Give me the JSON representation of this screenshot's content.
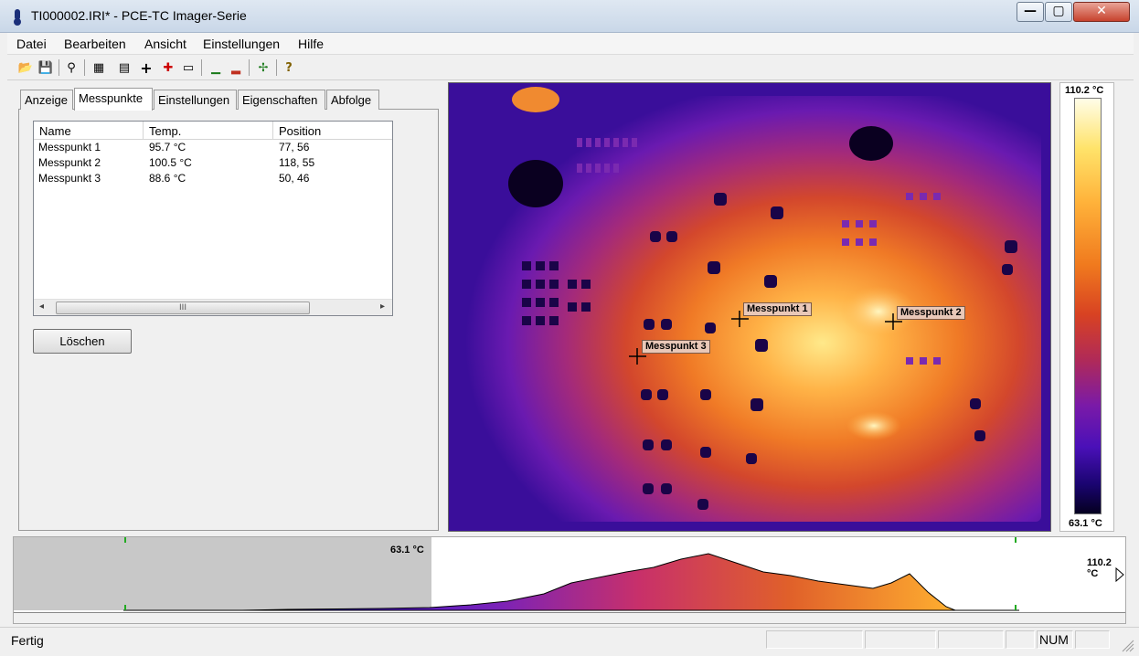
{
  "window": {
    "title": "TI000002.IRI* - PCE-TC Imager-Serie",
    "min_glyph": "—",
    "max_glyph": "▢",
    "close_glyph": "✕"
  },
  "menu": [
    "Datei",
    "Bearbeiten",
    "Ansicht",
    "Einstellungen",
    "Hilfe"
  ],
  "toolbar": {
    "icons": [
      "open-folder-icon",
      "save-icon",
      "binoculars-icon",
      "properties-icon",
      "report-icon",
      "crosshair-icon",
      "add-point-icon",
      "rectangle-icon",
      "histogram-icon",
      "bar-chart-icon",
      "line-profile-icon",
      "help-icon"
    ],
    "glyphs": [
      "📂",
      "💾",
      "⚲",
      "▦",
      "▤",
      "+",
      "✚",
      "▭",
      "▁",
      "▂",
      "✢",
      "?"
    ]
  },
  "tabs": [
    "Anzeige",
    "Messpunkte",
    "Einstellungen",
    "Eigenschaften",
    "Abfolge"
  ],
  "active_tab": "Messpunkte",
  "points_table": {
    "headers": [
      "Name",
      "Temp.",
      "Position"
    ],
    "rows": [
      [
        "Messpunkt 1",
        "95.7 °C",
        "77, 56"
      ],
      [
        "Messpunkt 2",
        "100.5 °C",
        "118, 55"
      ],
      [
        "Messpunkt 3",
        "88.6 °C",
        "50, 46"
      ]
    ],
    "scroll_left": "◂",
    "scroll_right": "▸",
    "scroll_thumb": "III"
  },
  "delete_button": "Löschen",
  "thermal_markers": [
    "Messpunkt 1",
    "Messpunkt 2",
    "Messpunkt 3"
  ],
  "colorbar": {
    "max": "110.2 °C",
    "min": "63.1 °C"
  },
  "histogram": {
    "min_label": "63.1 °C",
    "max_label": "110.2 °C"
  },
  "status": {
    "text": "Fertig",
    "num": "NUM"
  },
  "colors": {
    "hot": "#ffe36a",
    "mid": "#d84222",
    "cold": "#3a10a8"
  }
}
